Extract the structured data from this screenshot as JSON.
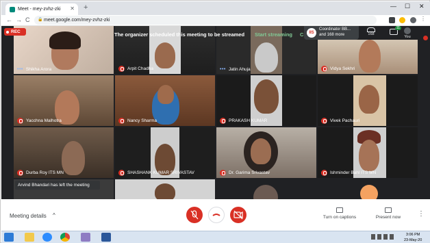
{
  "browser": {
    "tab_title": "Meet - mey-zvhz-zki",
    "url": "meet.google.com/mey-zvhz-zki",
    "new_tab": "+",
    "close_tab": "✕",
    "win_min": "—",
    "win_max": "☐",
    "win_close": "✕",
    "back": "←",
    "forward": "→",
    "reload": "C"
  },
  "meet": {
    "rec_label": "REC",
    "banner": "The organizer scheduled this meeting to be streamed",
    "start_streaming": "Start streaming",
    "cut_label": "C",
    "pip_line1": "Coordinator BB...",
    "pip_line2": "and 168 more",
    "people_count": "168",
    "chat_badge": "11",
    "you_label": "You",
    "toast": "Arvind Bhandari has left the meeting",
    "participants": [
      {
        "name": "Shikha Arora",
        "muted": false
      },
      {
        "name": "Arpit Chadha",
        "muted": true
      },
      {
        "name": "Jatin Ahuja",
        "muted": false
      },
      {
        "name": "Vidya Sekhri",
        "muted": true
      },
      {
        "name": "Yacchna Malhotra",
        "muted": true
      },
      {
        "name": "Nancy Sharma",
        "muted": true
      },
      {
        "name": "PRAKASH KUMAR",
        "muted": true
      },
      {
        "name": "Vivek Pachauri",
        "muted": true
      },
      {
        "name": "Durba Roy ITS MN",
        "muted": true
      },
      {
        "name": "SHASHANK KUMAR SRIVASTAV",
        "muted": true
      },
      {
        "name": "Dr. Garima Srivastav",
        "muted": true
      },
      {
        "name": "Ishminder Bahl ITS MN",
        "muted": true
      }
    ]
  },
  "controls": {
    "meeting_details": "Meeting details",
    "chevron": "^",
    "captions": "Turn on captions",
    "present": "Present now",
    "more": "⋮"
  },
  "taskbar": {
    "time": "3:06 PM",
    "date": "23-May-20"
  }
}
